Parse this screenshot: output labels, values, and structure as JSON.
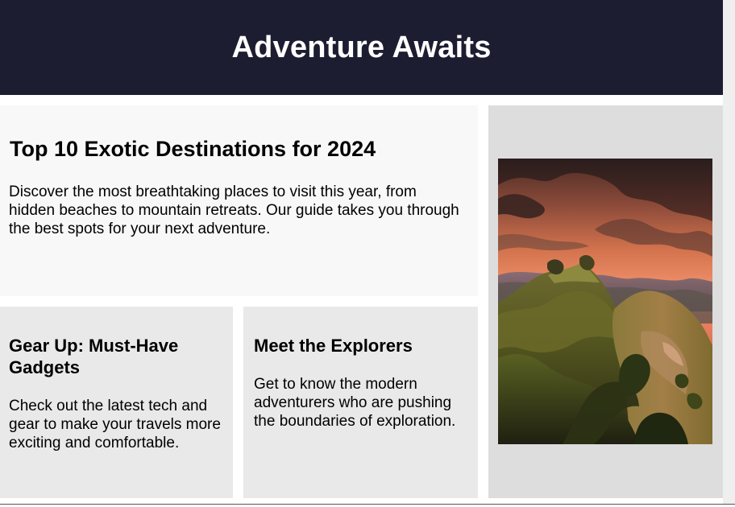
{
  "header": {
    "title": "Adventure Awaits"
  },
  "featured": {
    "title": "Top 10 Exotic Destinations for 2024",
    "description": "Discover the most breathtaking places to visit this year, from hidden beaches to mountain retreats. Our guide takes you through the best spots for your next adventure."
  },
  "cards": [
    {
      "title": "Gear Up: Must-Have Gadgets",
      "description": "Check out the latest tech and gear to make your travels more exciting and comfortable."
    },
    {
      "title": "Meet the Explorers",
      "description": "Get to know the modern adventurers who are pushing the boundaries of exploration."
    }
  ],
  "image": {
    "subject": "sunset over green mountain hills"
  },
  "colors": {
    "header_bg": "#1c1d31",
    "header_text": "#ffffff",
    "featured_bg": "#f8f8f8",
    "card_bg": "#e9e9e9",
    "image_panel_bg": "#dddddd"
  }
}
